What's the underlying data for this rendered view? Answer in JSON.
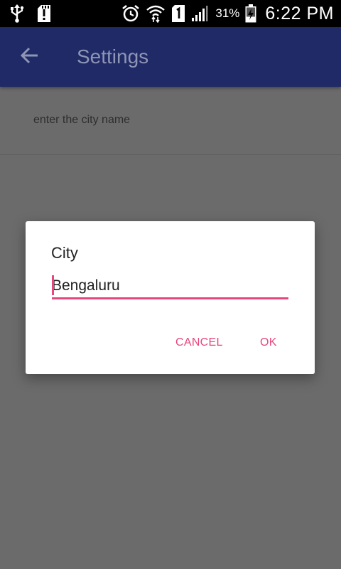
{
  "status_bar": {
    "icons": [
      "usb-icon",
      "sd-card-alert-icon",
      "alarm-icon",
      "wifi-icon",
      "sim-1-icon",
      "signal-icon",
      "battery-charging-icon"
    ],
    "battery_percent": "31%",
    "time": "6:22 PM"
  },
  "app_bar": {
    "title": "Settings",
    "background": "#1f2a66"
  },
  "preference": {
    "summary": "enter the city name"
  },
  "dialog": {
    "title": "City",
    "input_value": "Bengaluru",
    "cancel_label": "CANCEL",
    "ok_label": "OK",
    "accent": "#e8467f"
  }
}
